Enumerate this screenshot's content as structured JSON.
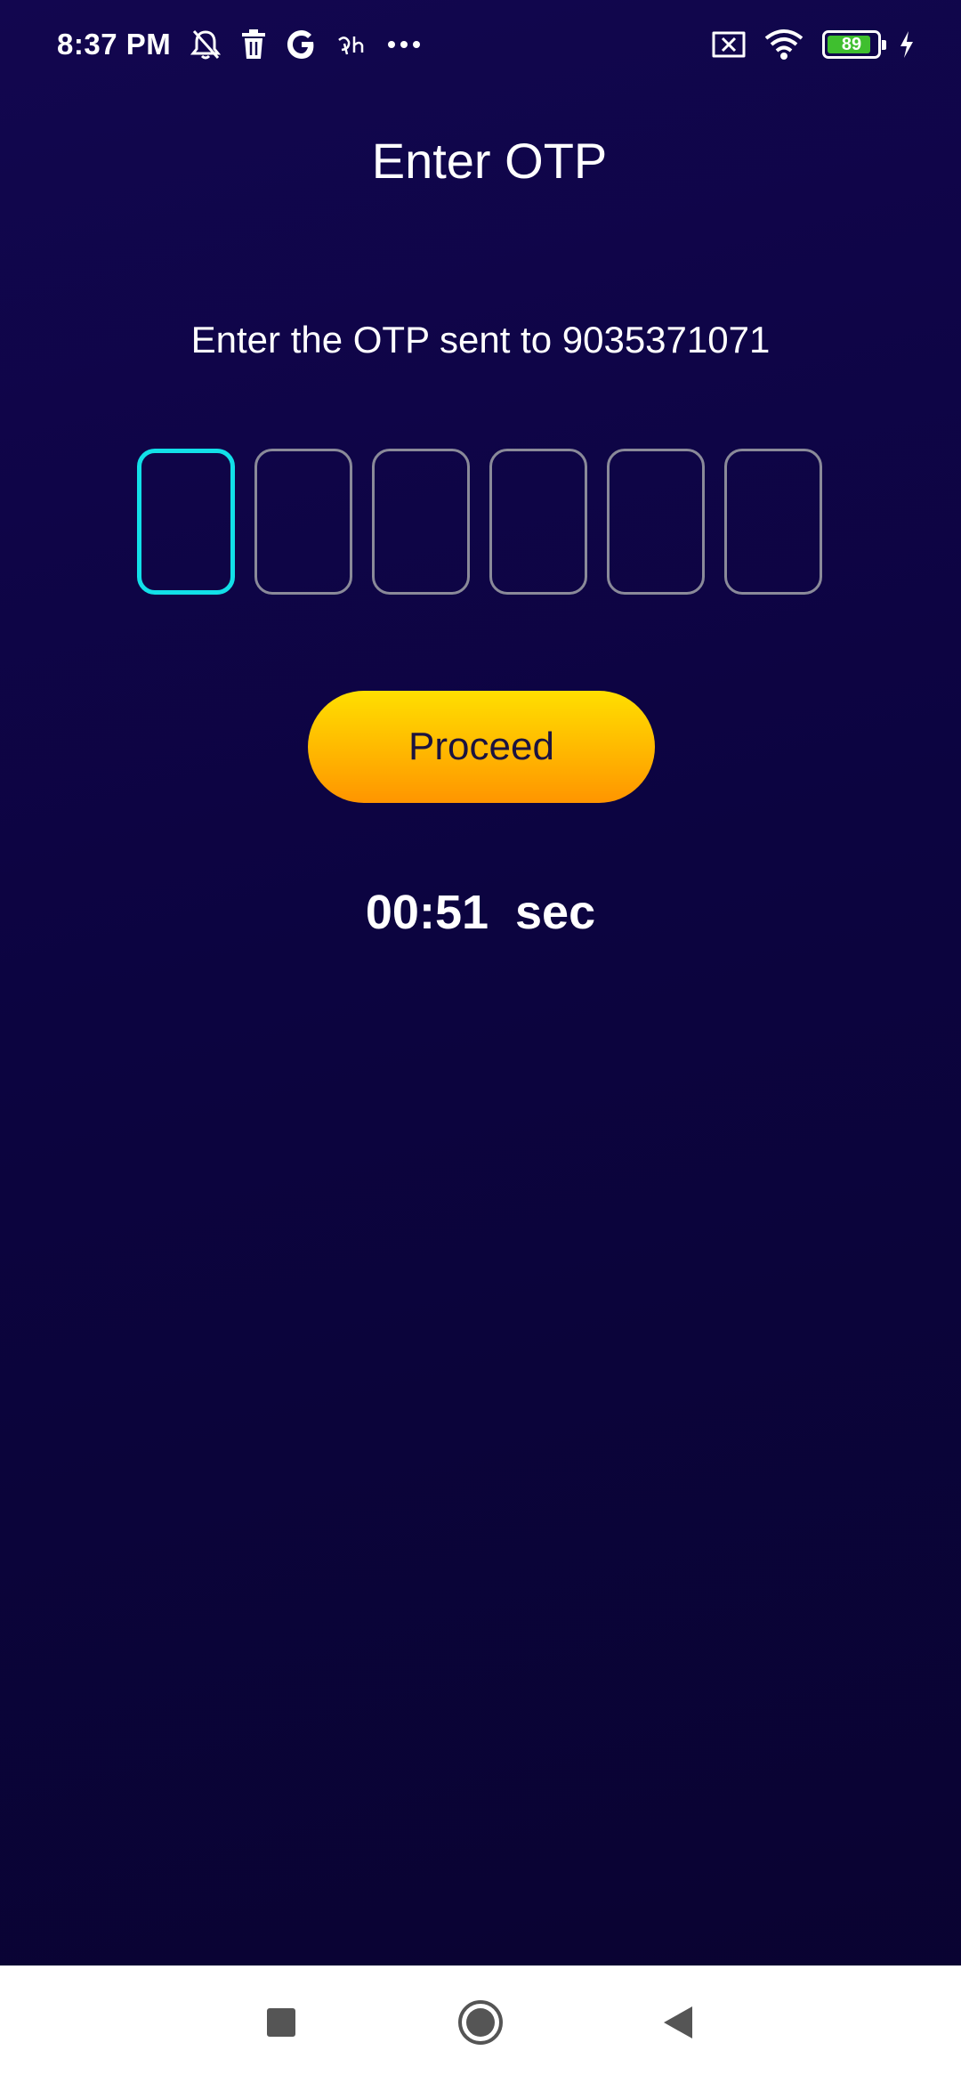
{
  "status_bar": {
    "time": "8:37 PM",
    "left_icons": [
      "bell-off-icon",
      "trash-icon",
      "google-icon",
      "app-icon",
      "more-icon"
    ],
    "right_icons": [
      "sim-x-icon",
      "wifi-icon",
      "battery-icon",
      "charging-icon"
    ],
    "battery_level": "89",
    "battery_color": "#3fbf2f"
  },
  "screen": {
    "title": "Enter OTP",
    "subtitle": "Enter the OTP sent to 9035371071",
    "otp": {
      "digits": [
        "",
        "",
        "",
        "",
        "",
        ""
      ],
      "active_index": 0,
      "active_border_color": "#12e0e8",
      "inactive_border_color": "#8a8a99"
    },
    "proceed_label": "Proceed",
    "timer": "00:51  sec"
  },
  "colors": {
    "background_top": "#12064f",
    "background_bottom": "#090330",
    "button_gradient_top": "#ffdf00",
    "button_gradient_bottom": "#ff9500"
  },
  "nav_bar": {
    "buttons": [
      "recents-button",
      "home-button",
      "back-button"
    ]
  }
}
